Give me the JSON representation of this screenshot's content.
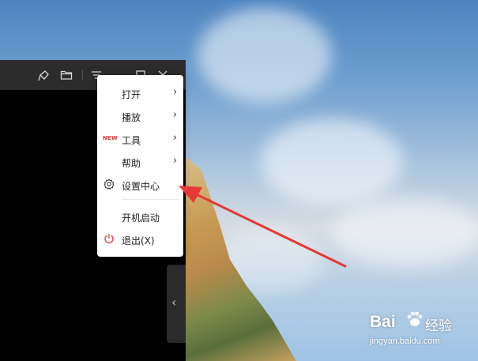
{
  "menu": {
    "items": [
      {
        "label": "打开",
        "has_submenu": true
      },
      {
        "label": "播放",
        "has_submenu": true
      },
      {
        "label": "工具",
        "has_submenu": true,
        "badge": "NEW"
      },
      {
        "label": "帮助",
        "has_submenu": true
      },
      {
        "label": "设置中心",
        "icon": "gear-icon"
      },
      {
        "label": "开机启动"
      },
      {
        "label": "退出(X)",
        "icon": "power-icon"
      }
    ]
  },
  "titlebar": {
    "icons": [
      "pin-icon",
      "folder-icon",
      "menu-icon",
      "minimize-icon",
      "maximize-icon",
      "close-icon"
    ]
  },
  "side_tab": {
    "glyph": "‹"
  },
  "watermark": {
    "brand": "Bai",
    "suffix": "经验",
    "url": "jingyan.baidu.com"
  },
  "colors": {
    "accent_red": "#e53935",
    "titlebar": "#2c2c2d",
    "menu_bg": "#ffffff"
  }
}
